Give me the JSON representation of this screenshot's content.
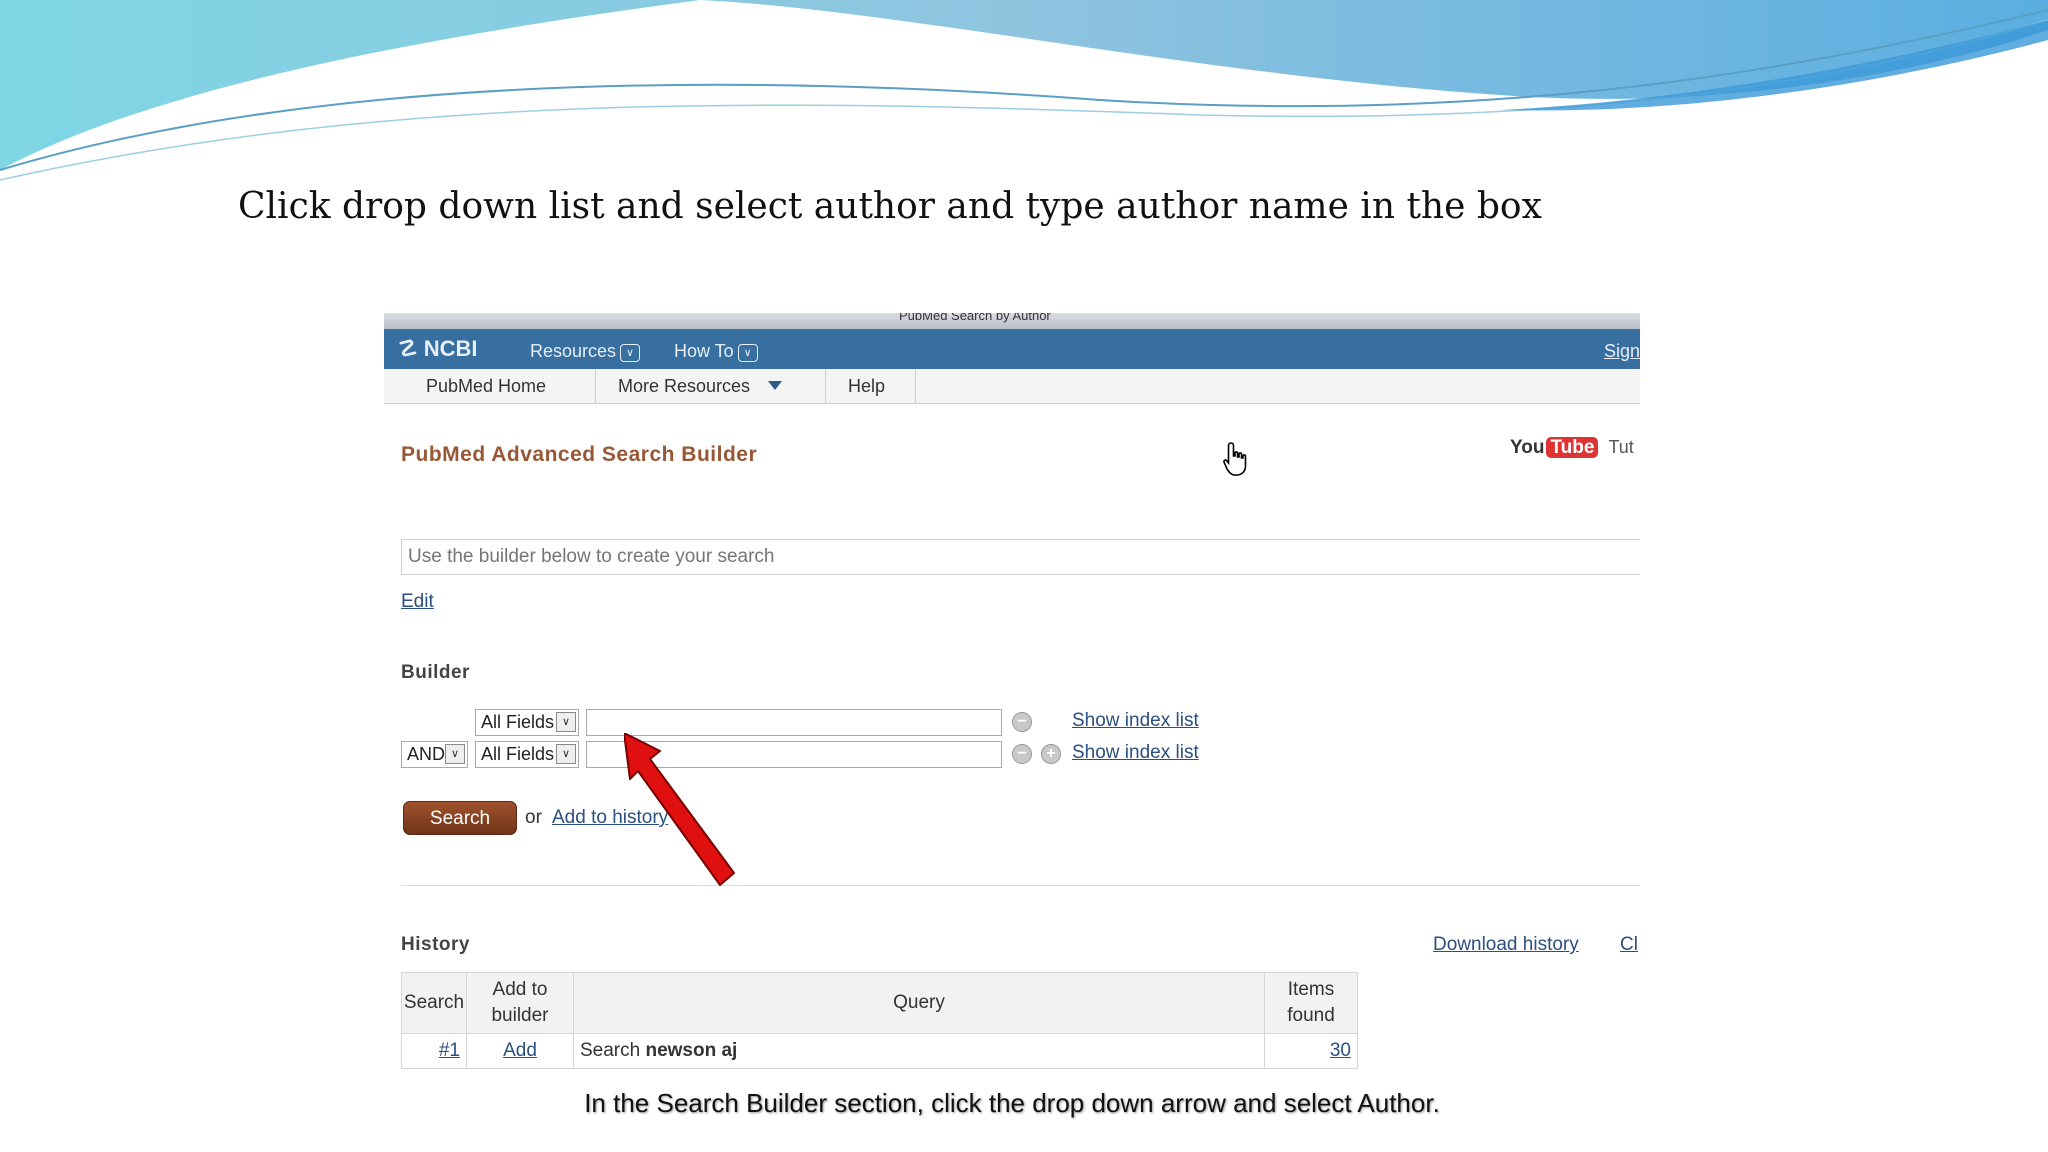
{
  "slide": {
    "instruction": "Click drop down list and select author and type author name in the box"
  },
  "browser": {
    "window_title": "PubMed Search by Author"
  },
  "ncbi_bar": {
    "logo": "NCBI",
    "resources": "Resources",
    "howto": "How To",
    "signin": "Sign"
  },
  "subnav": {
    "tabs": [
      "PubMed Home",
      "More Resources",
      "Help"
    ]
  },
  "page": {
    "title": "PubMed Advanced Search Builder",
    "youtube_you": "You",
    "youtube_tube": "Tube",
    "tutorial": "Tut",
    "query_placeholder": "Use the builder below to create your search",
    "edit": "Edit"
  },
  "builder": {
    "label": "Builder",
    "row1": {
      "field": "All Fields",
      "value": "",
      "index_link": "Show index list"
    },
    "row2": {
      "operator": "AND",
      "field": "All Fields",
      "value": "",
      "index_link": "Show index list"
    },
    "search_button": "Search",
    "or_text": "or",
    "add_to_history": "Add to history"
  },
  "history": {
    "label": "History",
    "download": "Download history",
    "clear": "Cl",
    "headers": {
      "search": "Search",
      "add_line1": "Add to",
      "add_line2": "builder",
      "query": "Query",
      "items_line1": "Items",
      "items_line2": "found"
    },
    "rows": [
      {
        "num": "#1",
        "add": "Add",
        "query_prefix": "Search ",
        "query_term": "newson aj",
        "items": "30"
      }
    ]
  },
  "caption": "In the Search Builder section, click the drop down arrow and select Author.",
  "colors": {
    "ncbi_bar": "#366fa0",
    "title_brown": "#985735",
    "search_button": "#8b4424",
    "link_blue": "#2a4f80",
    "arrow_red": "#e01010"
  }
}
